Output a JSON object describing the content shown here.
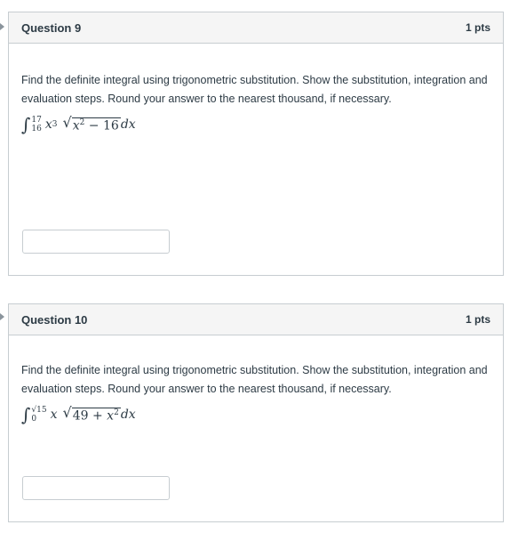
{
  "questions": [
    {
      "title": "Question 9",
      "points": "1 pts",
      "text": "Find the definite integral using trigonometric substitution. Show the substitution, integration and evaluation steps. Round your answer to the nearest thousand, if necessary.",
      "math": {
        "upper": "17",
        "lower": "16",
        "factor": "x",
        "factor_exp": "3",
        "radicand": "x",
        "radicand_exp": "2",
        "radicand_rest": " − 16",
        "differential": "dx"
      },
      "answer_value": ""
    },
    {
      "title": "Question 10",
      "points": "1 pts",
      "text": "Find the definite integral using trigonometric substitution. Show the substitution, integration and evaluation steps. Round your answer to the nearest thousand, if necessary.",
      "math": {
        "upper": "√15",
        "lower": "0",
        "factor": "x",
        "radicand_lead": "49 + ",
        "radicand": "x",
        "radicand_exp": "2",
        "differential": "dx"
      },
      "answer_value": ""
    }
  ]
}
